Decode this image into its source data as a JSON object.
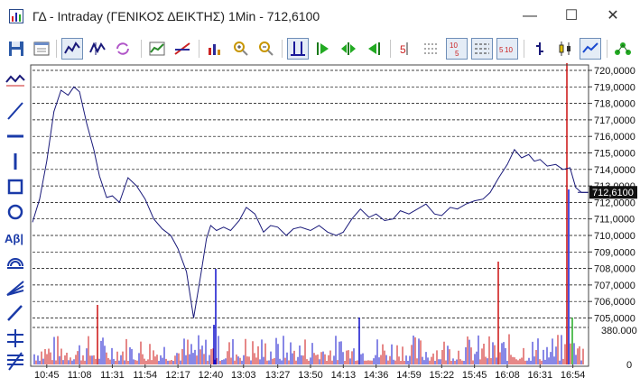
{
  "window": {
    "title": "ΓΔ - Intraday (ΓΕΝΙΚΟΣ ΔΕΙΚΤΗΣ) 1Min - 712,6100",
    "minimize_glyph": "—",
    "maximize_glyph": "☐",
    "close_glyph": "✕"
  },
  "toolbar": {
    "buttons": [
      "save-icon",
      "window-icon",
      "line-chart-icon",
      "bar-chart-icon",
      "refresh-icon",
      "indicator-icon",
      "trendline-icon",
      "volume-icon",
      "zoom-in-icon",
      "zoom-out-icon",
      "fit-icon",
      "scroll-start-icon",
      "scroll-center-icon",
      "scroll-end-icon",
      "period-5-icon",
      "grid-dots-icon",
      "period-10-5-icon",
      "grid-dash-icon",
      "period-5-10-icon",
      "bar-style-icon",
      "candle-style-icon",
      "line-style-icon",
      "connect-icon"
    ]
  },
  "sidebar": {
    "tools": [
      "zigzag-icon",
      "diagonal-line-icon",
      "horizontal-line-icon",
      "vertical-line-icon",
      "rectangle-icon",
      "circle-icon",
      "text-tool-icon",
      "arc-icon",
      "fan-icon",
      "pencil-icon",
      "channel-icon",
      "fibonacci-icon"
    ],
    "text_tool_label": "Aβ|"
  },
  "colors": {
    "price_line": "#1a1a7a",
    "current_price_bg": "#111111",
    "volume_up": "#cc1111",
    "volume_down": "#1111cc",
    "volume_neutral": "#22aa22",
    "grid": "#000000"
  },
  "chart_data": {
    "type": "line",
    "title": "",
    "price_axis": {
      "labels": [
        "720,0000",
        "719,0000",
        "718,0000",
        "717,0000",
        "716,0000",
        "715,0000",
        "714,0000",
        "713,0000",
        "712,0000",
        "711,0000",
        "710,0000",
        "709,0000",
        "708,0000",
        "707,0000",
        "706,0000",
        "705,0000"
      ],
      "ylim": [
        704.9,
        720.2
      ],
      "grid_values": [
        720,
        719,
        718,
        717,
        716,
        715,
        714,
        713,
        712,
        711,
        710,
        709,
        708,
        707,
        706,
        705
      ]
    },
    "current_price_label": "712,6100",
    "current_price": 712.61,
    "volume_axis": {
      "labels": [
        "380.000",
        "0"
      ]
    },
    "x_tick_labels": [
      "10:45",
      "11:08",
      "11:31",
      "11:54",
      "12:17",
      "12:40",
      "13:03",
      "13:27",
      "13:50",
      "14:13",
      "14:36",
      "14:59",
      "15:22",
      "15:45",
      "16:08",
      "16:31",
      "16:54"
    ],
    "series": [
      {
        "x": [
          "10:35",
          "10:40",
          "10:45",
          "10:50",
          "10:55",
          "11:00",
          "11:04",
          "11:08",
          "11:13",
          "11:18",
          "11:22",
          "11:27",
          "11:31",
          "11:36",
          "11:42",
          "11:48",
          "11:54",
          "12:00",
          "12:06",
          "12:12",
          "12:17",
          "12:23",
          "12:28",
          "12:33",
          "12:37",
          "12:40",
          "12:44",
          "12:49",
          "12:54",
          "13:00",
          "13:05",
          "13:11",
          "13:17",
          "13:22",
          "13:27",
          "13:33",
          "13:38",
          "13:43",
          "13:50",
          "13:56",
          "14:02",
          "14:08",
          "14:13",
          "14:19",
          "14:25",
          "14:31",
          "14:36",
          "14:42",
          "14:48",
          "14:53",
          "14:59",
          "15:05",
          "15:11",
          "15:17",
          "15:22",
          "15:28",
          "15:33",
          "15:39",
          "15:45",
          "15:51",
          "15:56",
          "16:02",
          "16:08",
          "16:13",
          "16:18",
          "16:23",
          "16:27",
          "16:31",
          "16:36",
          "16:42",
          "16:47",
          "16:52",
          "16:56",
          "17:00",
          "17:05"
        ],
        "values": [
          710.8,
          712.2,
          714.5,
          717.5,
          718.8,
          718.5,
          719.0,
          718.7,
          716.8,
          715.2,
          713.6,
          712.3,
          712.4,
          712.0,
          713.5,
          713.0,
          712.2,
          711.0,
          710.4,
          710.0,
          709.2,
          707.8,
          705.0,
          707.6,
          709.8,
          710.6,
          710.3,
          710.5,
          710.3,
          710.9,
          711.7,
          711.3,
          710.2,
          710.6,
          710.5,
          710.0,
          710.4,
          710.5,
          710.3,
          710.6,
          710.2,
          710.0,
          710.2,
          711.0,
          711.6,
          711.1,
          711.3,
          710.9,
          711.0,
          711.5,
          711.3,
          711.6,
          711.9,
          711.3,
          711.2,
          711.7,
          711.6,
          711.9,
          712.1,
          712.2,
          712.6,
          713.5,
          714.3,
          715.2,
          714.7,
          714.9,
          714.5,
          714.6,
          714.2,
          714.3,
          714.0,
          714.1,
          712.9,
          712.6,
          712.6
        ]
      }
    ]
  }
}
